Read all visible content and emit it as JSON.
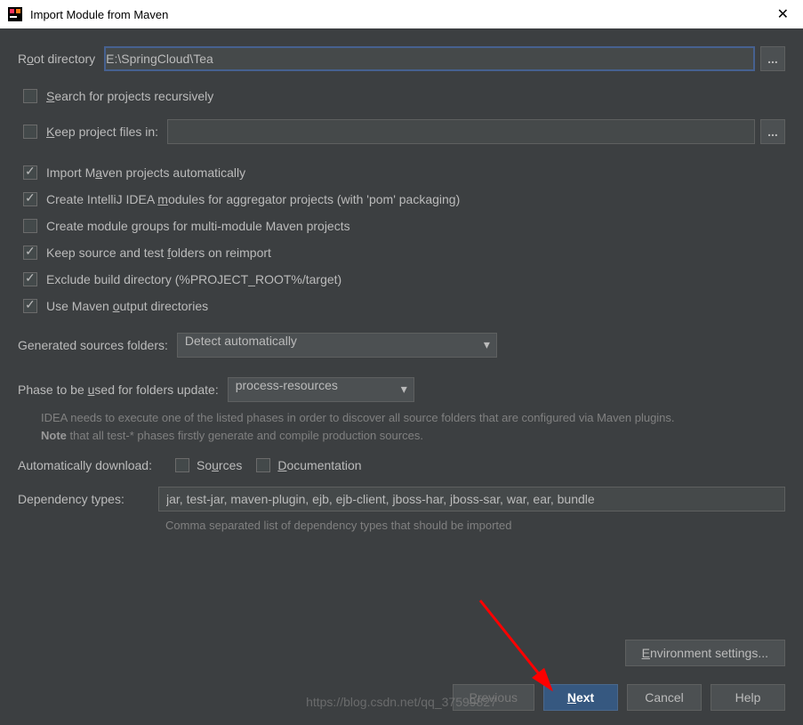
{
  "title": "Import Module from Maven",
  "root": {
    "label_pre": "R",
    "label_u": "o",
    "label_post": "ot directory",
    "value": "E:\\SpringCloud\\Tea",
    "browse": "..."
  },
  "checkboxes": {
    "search_recursively": "Search for projects recursively",
    "keep_project_files": "Keep project files in:",
    "keep_browse": "...",
    "import_auto": "Import Maven projects automatically",
    "create_modules": "Create IntelliJ IDEA modules for aggregator projects (with 'pom' packaging)",
    "create_groups": "Create module groups for multi-module Maven projects",
    "keep_source": "Keep source and test folders on reimport",
    "exclude_build": "Exclude build directory (%PROJECT_ROOT%/target)",
    "use_output": "Use Maven output directories"
  },
  "generated_folders": {
    "label": "Generated sources folders:",
    "value": "Detect automatically"
  },
  "phase": {
    "label": "Phase to be used for folders update:",
    "value": "process-resources",
    "hint1": "IDEA needs to execute one of the listed phases in order to discover all source folders that are configured via Maven plugins.",
    "hint2_bold": "Note",
    "hint2_rest": " that all test-* phases firstly generate and compile production sources."
  },
  "auto_download": {
    "label": "Automatically download:",
    "sources": "Sources",
    "docs": "Documentation"
  },
  "dep_types": {
    "label": "Dependency types:",
    "value": "jar, test-jar, maven-plugin, ejb, ejb-client, jboss-har, jboss-sar, war, ear, bundle",
    "hint": "Comma separated list of dependency types that should be imported"
  },
  "buttons": {
    "env": "Environment settings...",
    "previous": "Previous",
    "next": "Next",
    "cancel": "Cancel",
    "help": "Help"
  },
  "watermark": "https://blog.csdn.net/qq_37599827"
}
